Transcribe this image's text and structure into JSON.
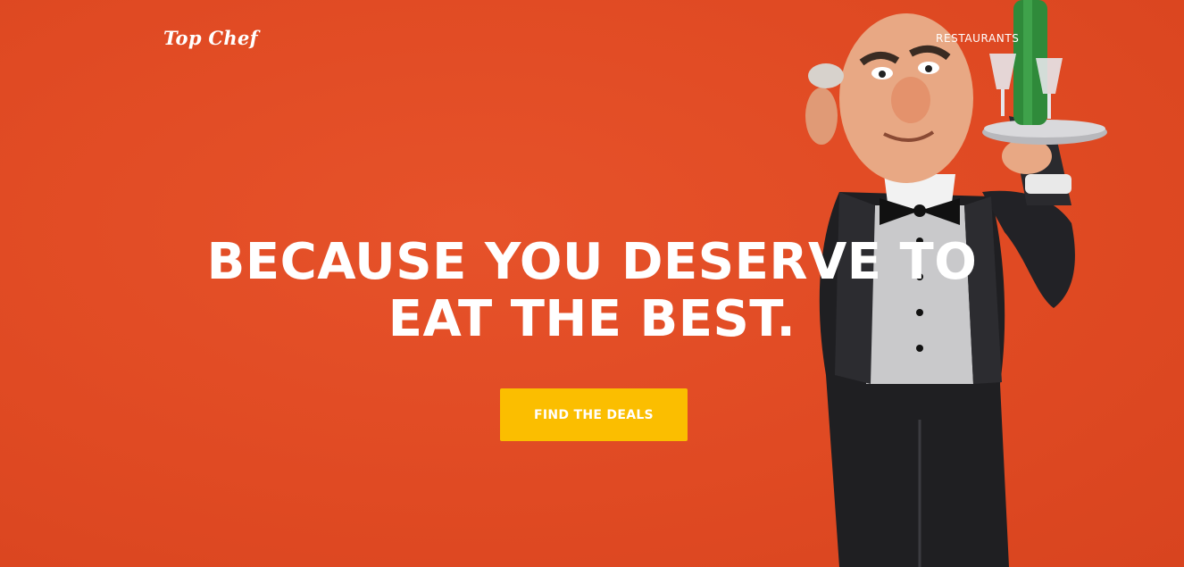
{
  "brand": {
    "logo_text": "Top Chef"
  },
  "nav": {
    "items": [
      {
        "label": "RESTAURANTS"
      }
    ]
  },
  "hero": {
    "headline_line1": "BECAUSE YOU DESERVE TO",
    "headline_line2": "EAT THE BEST.",
    "cta_label": "FIND THE DEALS"
  },
  "colors": {
    "background": "#e04a23",
    "cta": "#fbbe00",
    "text": "#ffffff"
  },
  "imagery": {
    "hero_figure": "waiter-figurine-with-tray"
  }
}
